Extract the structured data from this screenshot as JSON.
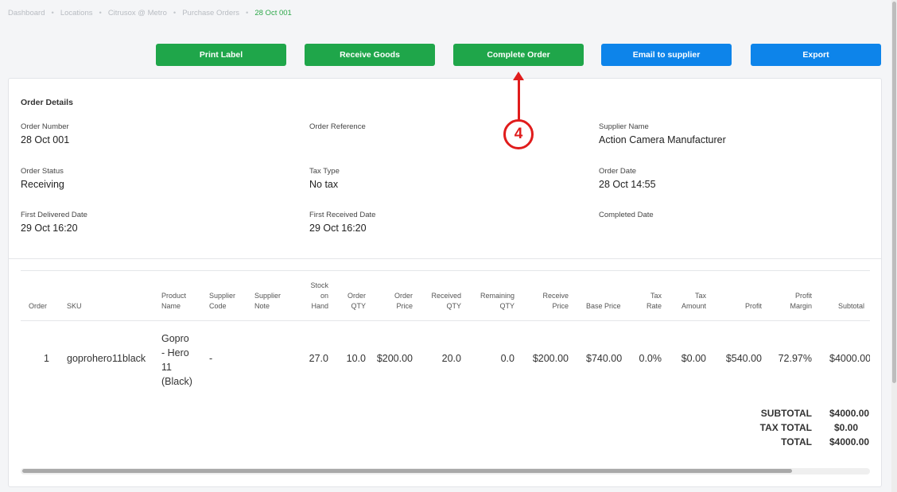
{
  "breadcrumb": {
    "items": [
      "Dashboard",
      "Locations",
      "Citrusox @ Metro",
      "Purchase Orders"
    ],
    "current": "28 Oct 001",
    "separator": "•"
  },
  "toolbar": {
    "print_label": "Print Label",
    "receive_goods": "Receive Goods",
    "complete_order": "Complete Order",
    "email_supplier": "Email to supplier",
    "export": "Export"
  },
  "annotation": {
    "step": "4"
  },
  "details": {
    "title": "Order Details",
    "order_number_label": "Order Number",
    "order_number": "28 Oct 001",
    "order_reference_label": "Order Reference",
    "order_reference": "",
    "supplier_name_label": "Supplier Name",
    "supplier_name": "Action Camera Manufacturer",
    "order_status_label": "Order Status",
    "order_status": "Receiving",
    "tax_type_label": "Tax Type",
    "tax_type": "No tax",
    "order_date_label": "Order Date",
    "order_date": "28 Oct 14:55",
    "first_delivered_label": "First Delivered Date",
    "first_delivered": "29 Oct 16:20",
    "first_received_label": "First Received Date",
    "first_received": "29 Oct 16:20",
    "completed_label": "Completed Date",
    "completed": ""
  },
  "table": {
    "headers": {
      "order": "Order",
      "sku": "SKU",
      "product_name": "Product\nName",
      "supplier_code": "Supplier\nCode",
      "supplier_note": "Supplier\nNote",
      "stock_on_hand": "Stock\non\nHand",
      "order_qty": "Order\nQTY",
      "order_price": "Order\nPrice",
      "received_qty": "Received\nQTY",
      "remaining_qty": "Remaining\nQTY",
      "receive_price": "Receive\nPrice",
      "base_price": "Base Price",
      "tax_rate": "Tax\nRate",
      "tax_amount": "Tax\nAmount",
      "profit": "Profit",
      "profit_margin": "Profit\nMargin",
      "subtotal": "Subtotal"
    },
    "rows": [
      {
        "order": "1",
        "sku": "goprohero11black",
        "product_name": "Gopro\n- Hero\n11\n(Black)",
        "supplier_code": "-",
        "supplier_note": "",
        "stock_on_hand": "27.0",
        "order_qty": "10.0",
        "order_price": "$200.00",
        "received_qty": "20.0",
        "remaining_qty": "0.0",
        "receive_price": "$200.00",
        "base_price": "$740.00",
        "tax_rate": "0.0%",
        "tax_amount": "$0.00",
        "profit": "$540.00",
        "profit_margin": "72.97%",
        "subtotal": "$4000.00"
      }
    ],
    "totals": {
      "subtotal_label": "SUBTOTAL",
      "subtotal": "$4000.00",
      "tax_total_label": "TAX TOTAL",
      "tax_total": "$0.00",
      "total_label": "TOTAL",
      "total": "$4000.00"
    }
  }
}
